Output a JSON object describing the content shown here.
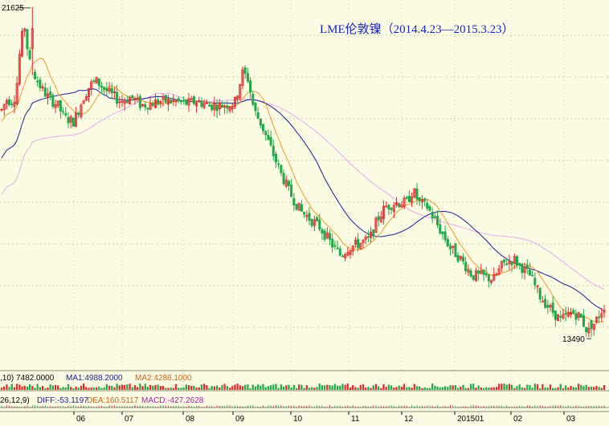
{
  "colors": {
    "background": "#fcfce4",
    "grid": "#c8c8a8",
    "up": "#e4282a",
    "down": "#22a84a",
    "ma_fast": "#e89a22",
    "ma_mid": "#1a1a9a",
    "ma_slow": "#e2a8ec",
    "title": "#1a22c8"
  },
  "chart_data": {
    "type": "candlestick",
    "title": "LME伦敦镍（2014.4.23—2015.3.23）",
    "high_label": "21625",
    "low_label": "13490",
    "ylim": [
      12700,
      21800
    ],
    "x_ticks": [
      "06",
      "07",
      "08",
      "09",
      "10",
      "11",
      "12",
      "201501",
      "02",
      "03"
    ],
    "grid": true,
    "candles": [],
    "moving_averages": [
      "ma_fast",
      "ma_mid",
      "ma_slow"
    ]
  },
  "volume_panel": {
    "left_text": ",10) 7482.0000",
    "ma1_text": "MA1:4988.2000",
    "ma2_text": "MA2:4288.1000"
  },
  "macd_panel": {
    "left_text": "26,12,9)",
    "diff_text": "DIFF:-53.1197",
    "dea_text": "DEA:160.5117",
    "macd_text": "MACD:-427.2628"
  }
}
